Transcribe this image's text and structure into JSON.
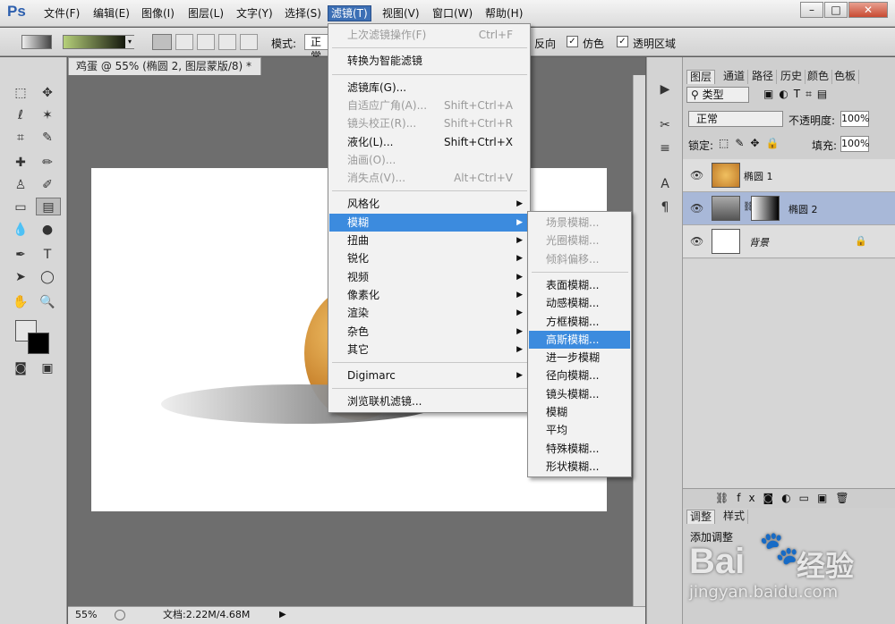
{
  "app": {
    "logo": "Ps"
  },
  "menubar": {
    "items": [
      "文件(F)",
      "编辑(E)",
      "图像(I)",
      "图层(L)",
      "文字(Y)",
      "选择(S)",
      "滤镜(T)",
      "视图(V)",
      "窗口(W)",
      "帮助(H)"
    ],
    "window_buttons": [
      "–",
      "□",
      "✕"
    ]
  },
  "options": {
    "mode_label": "模式:",
    "mode_value": "正常",
    "reverse_label": "反向",
    "dither_label": "仿色",
    "transparency_label": "透明区域"
  },
  "document": {
    "tab_title": "鸡蛋 @ 55% (椭圆 2, 图层蒙版/8) *",
    "zoom": "55%",
    "doc_info": "文档:2.22M/4.68M"
  },
  "filter_menu": {
    "items": [
      {
        "label": "上次滤镜操作(F)",
        "shortcut": "Ctrl+F",
        "disabled": true
      },
      {
        "sep": true
      },
      {
        "label": "转换为智能滤镜"
      },
      {
        "sep": true
      },
      {
        "label": "滤镜库(G)..."
      },
      {
        "label": "自适应广角(A)...",
        "shortcut": "Shift+Ctrl+A",
        "disabled": true
      },
      {
        "label": "镜头校正(R)...",
        "shortcut": "Shift+Ctrl+R",
        "disabled": true
      },
      {
        "label": "液化(L)...",
        "shortcut": "Shift+Ctrl+X"
      },
      {
        "label": "油画(O)...",
        "disabled": true
      },
      {
        "label": "消失点(V)...",
        "shortcut": "Alt+Ctrl+V",
        "disabled": true
      },
      {
        "sep": true
      },
      {
        "label": "风格化",
        "sub": true
      },
      {
        "label": "模糊",
        "sub": true,
        "highlight": true
      },
      {
        "label": "扭曲",
        "sub": true
      },
      {
        "label": "锐化",
        "sub": true
      },
      {
        "label": "视频",
        "sub": true
      },
      {
        "label": "像素化",
        "sub": true
      },
      {
        "label": "渲染",
        "sub": true
      },
      {
        "label": "杂色",
        "sub": true
      },
      {
        "label": "其它",
        "sub": true
      },
      {
        "sep": true
      },
      {
        "label": "Digimarc",
        "sub": true
      },
      {
        "sep": true
      },
      {
        "label": "浏览联机滤镜..."
      }
    ]
  },
  "blur_submenu": {
    "items": [
      {
        "label": "场景模糊...",
        "disabled": true
      },
      {
        "label": "光圈模糊...",
        "disabled": true
      },
      {
        "label": "倾斜偏移...",
        "disabled": true
      },
      {
        "sep": true
      },
      {
        "label": "表面模糊..."
      },
      {
        "label": "动感模糊..."
      },
      {
        "label": "方框模糊..."
      },
      {
        "label": "高斯模糊...",
        "highlight": true
      },
      {
        "label": "进一步模糊"
      },
      {
        "label": "径向模糊..."
      },
      {
        "label": "镜头模糊..."
      },
      {
        "label": "模糊"
      },
      {
        "label": "平均"
      },
      {
        "label": "特殊模糊..."
      },
      {
        "label": "形状模糊..."
      }
    ]
  },
  "layers_panel": {
    "tabs": [
      "图层",
      "通道",
      "路径",
      "历史",
      "颜色",
      "色板"
    ],
    "filter_kind": "类型",
    "blend_mode": "正常",
    "opacity_label": "不透明度:",
    "opacity_value": "100%",
    "lock_label": "锁定:",
    "fill_label": "填充:",
    "fill_value": "100%",
    "layers": [
      {
        "name": "椭圆 1"
      },
      {
        "name": "椭圆 2"
      },
      {
        "name": "背景"
      }
    ]
  },
  "adjust_panel": {
    "tabs": [
      "调整",
      "样式"
    ],
    "title": "添加调整"
  },
  "watermark": {
    "brand": "Bai",
    "brand2": "经验",
    "url": "jingyan.baidu.com"
  }
}
